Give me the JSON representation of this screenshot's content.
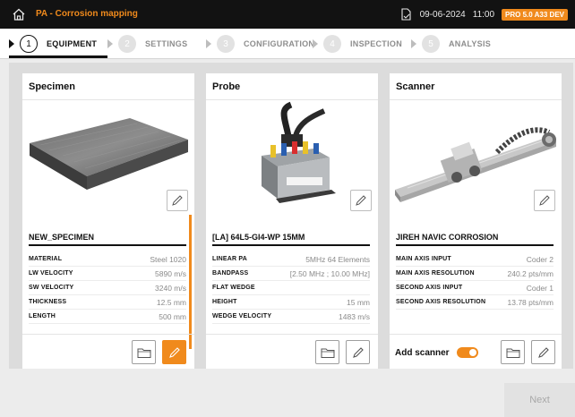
{
  "app": {
    "title": "PA - Corrosion mapping",
    "date": "09-06-2024",
    "time": "11:00",
    "badge": "PRO 5.0 A33 DEV"
  },
  "steps": [
    {
      "num": "1",
      "label": "EQUIPMENT"
    },
    {
      "num": "2",
      "label": "SETTINGS"
    },
    {
      "num": "3",
      "label": "CONFIGURATION"
    },
    {
      "num": "4",
      "label": "INSPECTION"
    },
    {
      "num": "5",
      "label": "ANALYSIS"
    }
  ],
  "specimen": {
    "title": "Specimen",
    "name": "NEW_SPECIMEN",
    "props": [
      {
        "key": "MATERIAL",
        "value": "Steel 1020"
      },
      {
        "key": "LW VELOCITY",
        "value": "5890 m/s"
      },
      {
        "key": "SW VELOCITY",
        "value": "3240 m/s"
      },
      {
        "key": "THICKNESS",
        "value": "12.5 mm"
      },
      {
        "key": "LENGTH",
        "value": "500 mm"
      }
    ]
  },
  "probe": {
    "title": "Probe",
    "name": "[LA] 64L5-GI4-WP 15MM",
    "props": [
      {
        "key": "LINEAR PA",
        "value": "5MHz   64 Elements"
      },
      {
        "key": "BANDPASS",
        "value": "[2.50 MHz ; 10.00 MHz]"
      },
      {
        "key": "FLAT WEDGE",
        "value": ""
      },
      {
        "key": "HEIGHT",
        "value": "15 mm"
      },
      {
        "key": "WEDGE VELOCITY",
        "value": "1483 m/s"
      }
    ]
  },
  "scanner": {
    "title": "Scanner",
    "name": "JIREH NAVIC CORROSION",
    "props": [
      {
        "key": "MAIN AXIS INPUT",
        "value": "Coder 2"
      },
      {
        "key": "MAIN AXIS RESOLUTION",
        "value": "240.2 pts/mm"
      },
      {
        "key": "SECOND AXIS INPUT",
        "value": "Coder 1"
      },
      {
        "key": "SECOND AXIS RESOLUTION",
        "value": "13.78 pts/mm"
      }
    ],
    "add_label": "Add scanner",
    "add_enabled": true
  },
  "next_label": "Next",
  "colors": {
    "accent": "#f08a1c",
    "titlebar": "#121212"
  }
}
